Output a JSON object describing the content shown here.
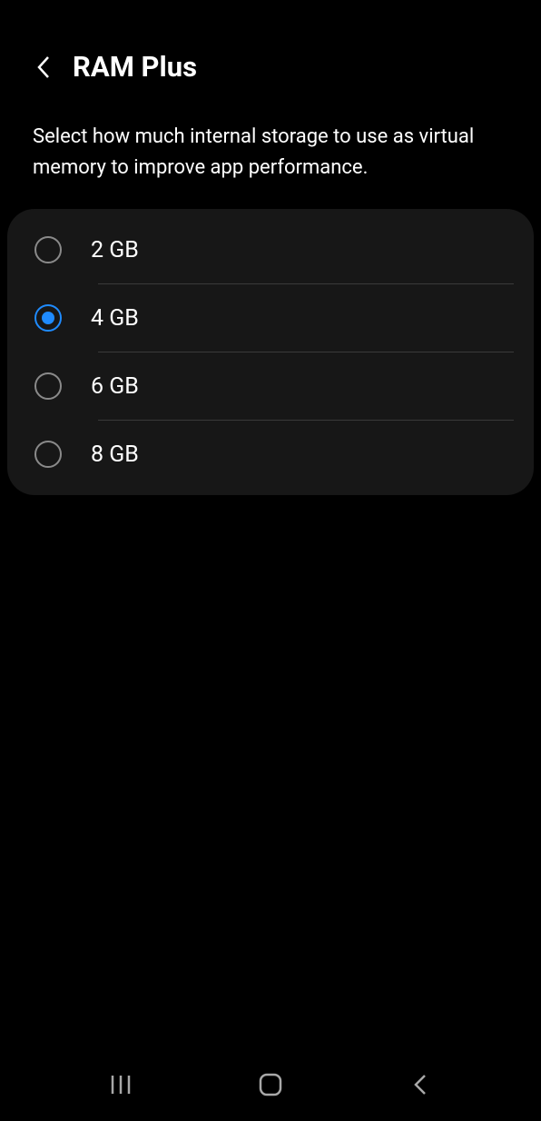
{
  "header": {
    "title": "RAM Plus"
  },
  "description": "Select how much internal storage to use as virtual memory to improve app performance.",
  "options": [
    {
      "label": "2 GB",
      "selected": false
    },
    {
      "label": "4 GB",
      "selected": true
    },
    {
      "label": "6 GB",
      "selected": false
    },
    {
      "label": "8 GB",
      "selected": false
    }
  ],
  "colors": {
    "accent": "#1f8bff",
    "background": "#000000",
    "panel": "#171717"
  }
}
